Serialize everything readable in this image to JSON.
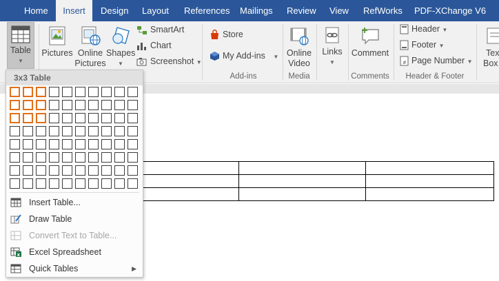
{
  "tabs": [
    "Home",
    "Insert",
    "Design",
    "Layout",
    "References",
    "Mailings",
    "Review",
    "View",
    "RefWorks",
    "PDF-XChange V6"
  ],
  "active_tab": "Insert",
  "ribbon": {
    "table_label": "Table",
    "pictures_label": "Pictures",
    "online_pictures_line1": "Online",
    "online_pictures_line2": "Pictures",
    "shapes_label": "Shapes",
    "smartart_label": "SmartArt",
    "chart_label": "Chart",
    "screenshot_label": "Screenshot",
    "store_label": "Store",
    "myaddins_label": "My Add-ins",
    "online_video_line1": "Online",
    "online_video_line2": "Video",
    "links_label": "Links",
    "comment_label": "Comment",
    "header_label": "Header",
    "footer_label": "Footer",
    "page_number_label": "Page Number",
    "textbox_line1": "Text",
    "textbox_line2": "Box",
    "groups": {
      "addins": "Add-ins",
      "media": "Media",
      "comments": "Comments",
      "header_footer": "Header & Footer"
    }
  },
  "dropdown": {
    "title": "3x3 Table",
    "grid_cols": 10,
    "grid_rows": 8,
    "selected_cols": 3,
    "selected_rows": 3,
    "items": [
      {
        "label": "Insert Table...",
        "icon": "insert-table-icon",
        "disabled": false
      },
      {
        "label": "Draw Table",
        "icon": "draw-table-icon",
        "disabled": false
      },
      {
        "label": "Convert Text to Table...",
        "icon": "convert-text-icon",
        "disabled": true
      },
      {
        "label": "Excel Spreadsheet",
        "icon": "excel-icon",
        "disabled": false
      },
      {
        "label": "Quick Tables",
        "icon": "quick-tables-icon",
        "disabled": false,
        "submenu": true
      }
    ]
  },
  "colors": {
    "tab_bar": "#2b579a",
    "ribbon_bg": "#f1f1f1",
    "selection_orange": "#e0701a"
  }
}
